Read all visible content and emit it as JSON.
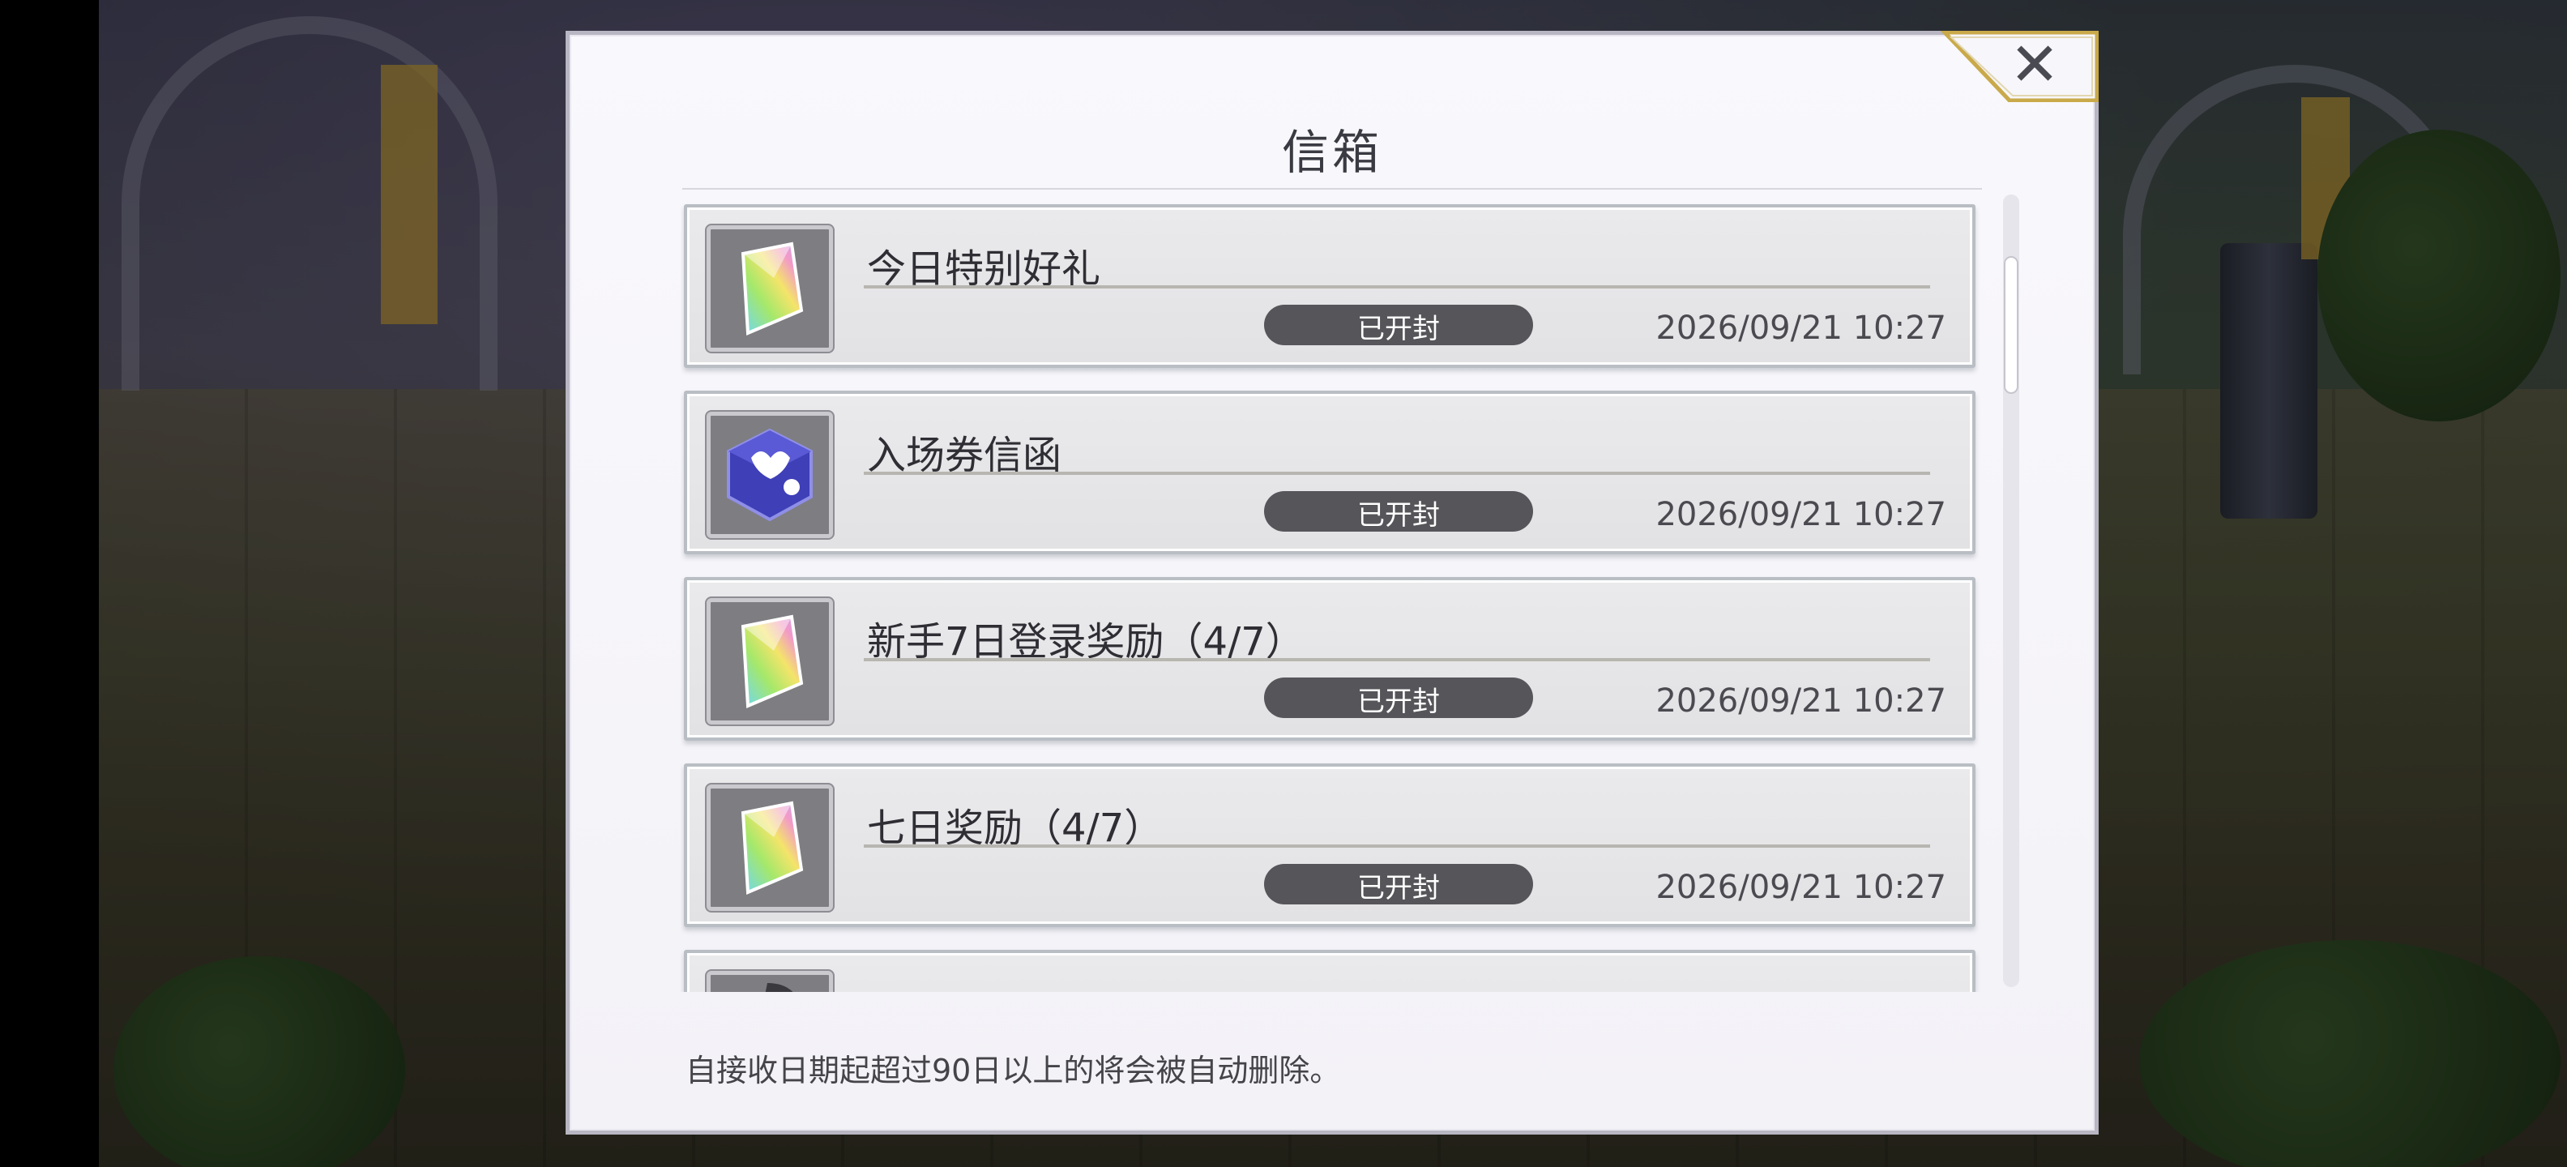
{
  "dialog": {
    "title": "信箱",
    "footer_note": "自接收日期起超过90日以上的将会被自动删除。"
  },
  "mail_list": {
    "items": [
      {
        "title": "今日特别好礼",
        "status": "已开封",
        "date": "2026/09/21 10:27",
        "icon": "rainbow-crystal-icon"
      },
      {
        "title": "入场券信函",
        "status": "已开封",
        "date": "2026/09/21 10:27",
        "icon": "blue-ticket-cube-icon"
      },
      {
        "title": "新手7日登录奖励（4/7）",
        "status": "已开封",
        "date": "2026/09/21 10:27",
        "icon": "rainbow-crystal-icon"
      },
      {
        "title": "七日奖励（4/7）",
        "status": "已开封",
        "date": "2026/09/21 10:27",
        "icon": "rainbow-crystal-icon"
      },
      {
        "title": "",
        "status": "",
        "date": "",
        "icon": "gray-item-icon"
      }
    ]
  },
  "colors": {
    "dialog_bg": "#f6f5fa",
    "status_pill": "#55555a",
    "close_tab_gold": "#c9a94a"
  }
}
